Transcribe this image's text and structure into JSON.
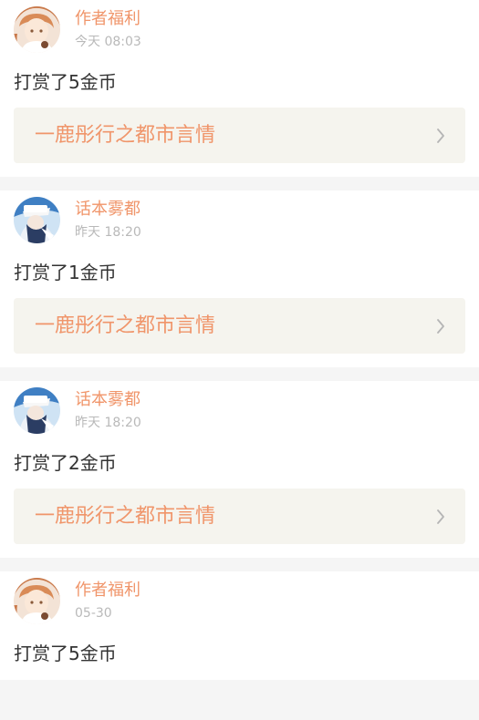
{
  "feed": [
    {
      "avatar": "author-avatar-icon",
      "user": "作者福利",
      "time": "今天 08:03",
      "reward": "打赏了5金币",
      "book": "一鹿彤行之都市言情"
    },
    {
      "avatar": "user-avatar-icon",
      "user": "话本雾都",
      "time": "昨天 18:20",
      "reward": "打赏了1金币",
      "book": "一鹿彤行之都市言情"
    },
    {
      "avatar": "user-avatar-icon",
      "user": "话本雾都",
      "time": "昨天 18:20",
      "reward": "打赏了2金币",
      "book": "一鹿彤行之都市言情"
    },
    {
      "avatar": "author-avatar-icon",
      "user": "作者福利",
      "time": "05-30",
      "reward": "打赏了5金币"
    }
  ],
  "colors": {
    "accent": "#f0956a",
    "text": "#333333",
    "muted": "#b9b9b9",
    "link_bg": "#f5f4ee",
    "divider": "#f5f5f5"
  }
}
